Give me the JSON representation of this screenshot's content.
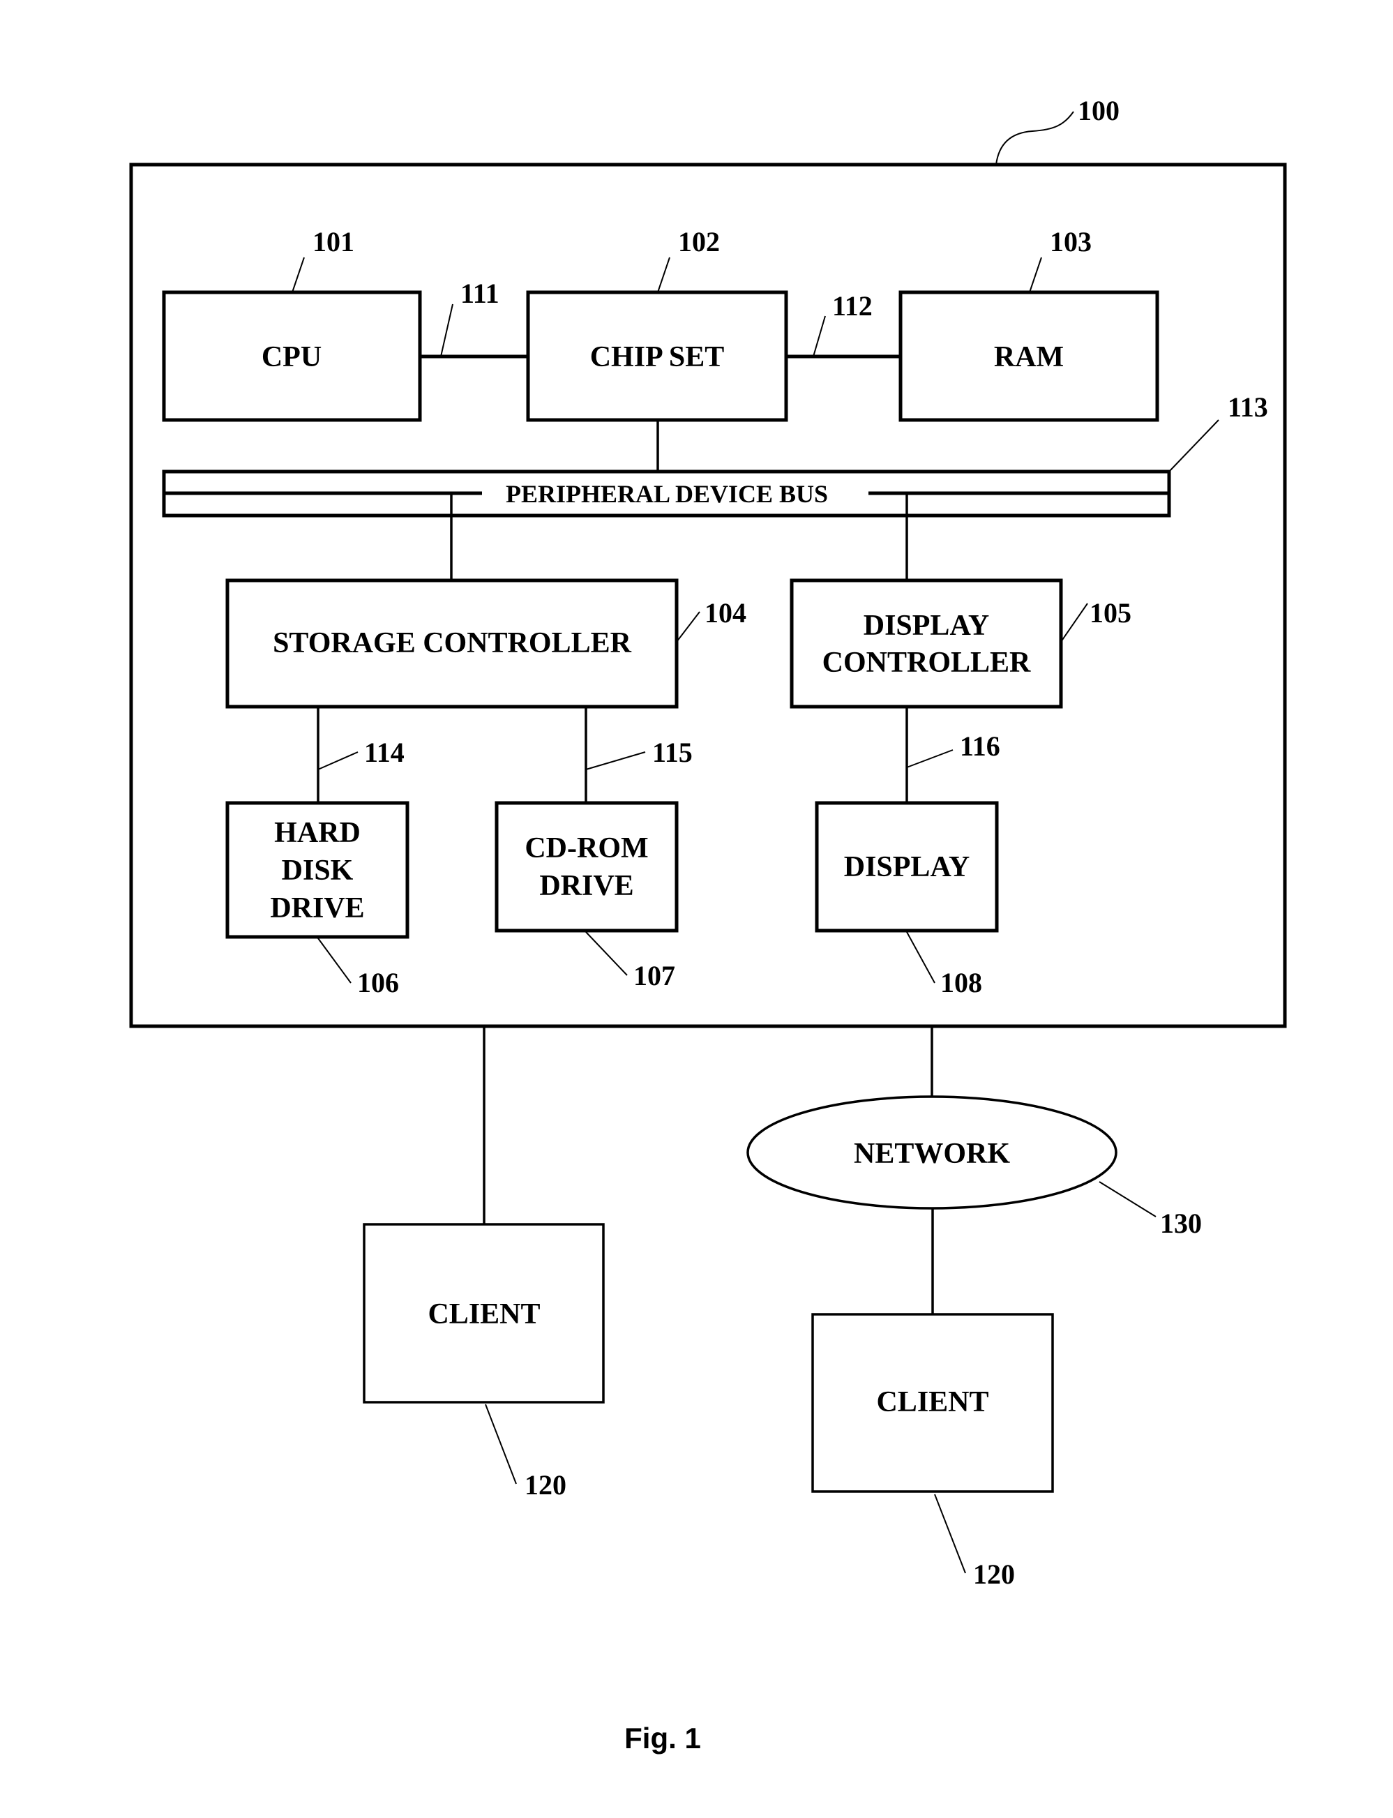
{
  "figure": {
    "caption": "Fig. 1",
    "system": {
      "ref": "100"
    },
    "components": {
      "cpu": {
        "label": "CPU",
        "ref": "101"
      },
      "chipset": {
        "label": "CHIP SET",
        "ref": "102"
      },
      "ram": {
        "label": "RAM",
        "ref": "103"
      },
      "storage_controller": {
        "label": "STORAGE CONTROLLER",
        "ref": "104"
      },
      "display_controller": {
        "label_lines": [
          "DISPLAY",
          "CONTROLLER"
        ],
        "ref": "105"
      },
      "hard_disk_drive": {
        "label_lines": [
          "HARD",
          "DISK",
          "DRIVE"
        ],
        "ref": "106"
      },
      "cdrom_drive": {
        "label_lines": [
          "CD-ROM",
          "DRIVE"
        ],
        "ref": "107"
      },
      "display": {
        "label": "DISPLAY",
        "ref": "108"
      },
      "peripheral_bus": {
        "label": "PERIPHERAL DEVICE BUS",
        "ref": "113"
      },
      "network": {
        "label": "NETWORK",
        "ref": "130"
      },
      "client_1": {
        "label": "CLIENT",
        "ref": "120"
      },
      "client_2": {
        "label": "CLIENT",
        "ref": "120"
      }
    },
    "connections": {
      "cpu_chipset": {
        "ref": "111"
      },
      "chipset_ram": {
        "ref": "112"
      },
      "storage_hdd": {
        "ref": "114"
      },
      "storage_cdrom": {
        "ref": "115"
      },
      "displayctrl_display": {
        "ref": "116"
      }
    }
  }
}
